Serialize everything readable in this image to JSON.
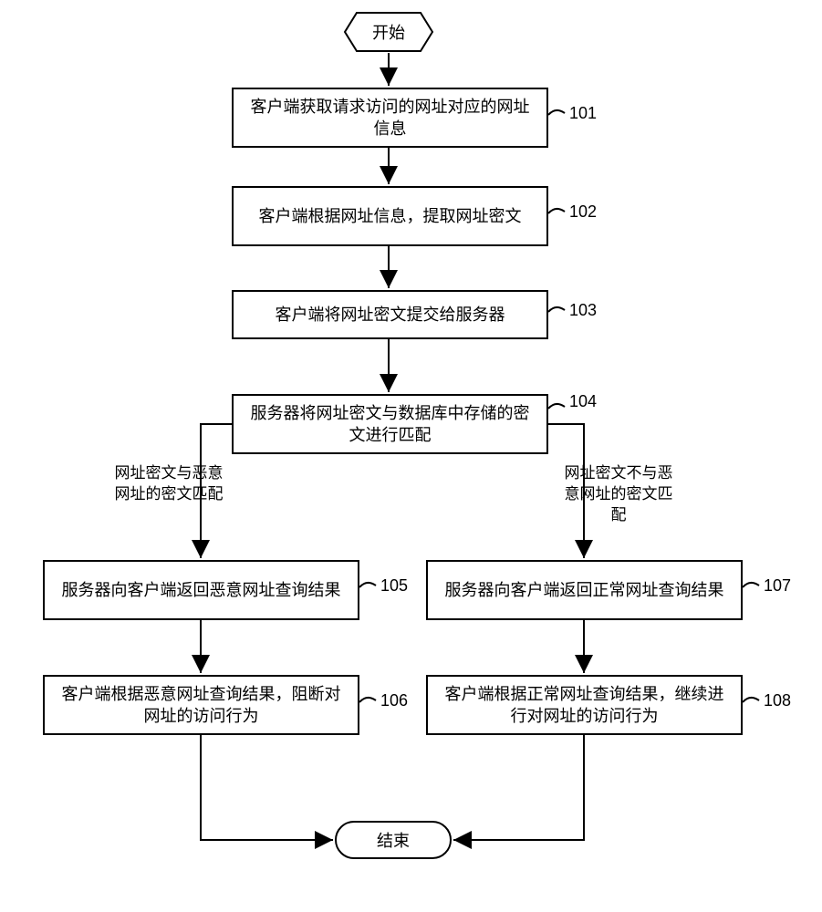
{
  "chart_data": {
    "type": "flowchart",
    "start": "开始",
    "end": "结束",
    "steps": [
      {
        "id": 101,
        "text": "客户端获取请求访问的网址对应的网址信息"
      },
      {
        "id": 102,
        "text": "客户端根据网址信息，提取网址密文"
      },
      {
        "id": 103,
        "text": "客户端将网址密文提交给服务器"
      },
      {
        "id": 104,
        "text": "服务器将网址密文与数据库中存储的密文进行匹配"
      },
      {
        "id": 105,
        "text": "服务器向客户端返回恶意网址查询结果"
      },
      {
        "id": 106,
        "text": "客户端根据恶意网址查询结果，阻断对网址的访问行为"
      },
      {
        "id": 107,
        "text": "服务器向客户端返回正常网址查询结果"
      },
      {
        "id": 108,
        "text": "客户端根据正常网址查询结果，继续进行对网址的访问行为"
      }
    ],
    "branches": {
      "left": "网址密文与恶意网址的密文匹配",
      "right": "网址密文不与恶意网址的密文匹配"
    }
  },
  "labels": {
    "n101": "101",
    "n102": "102",
    "n103": "103",
    "n104": "104",
    "n105": "105",
    "n106": "106",
    "n107": "107",
    "n108": "108"
  }
}
